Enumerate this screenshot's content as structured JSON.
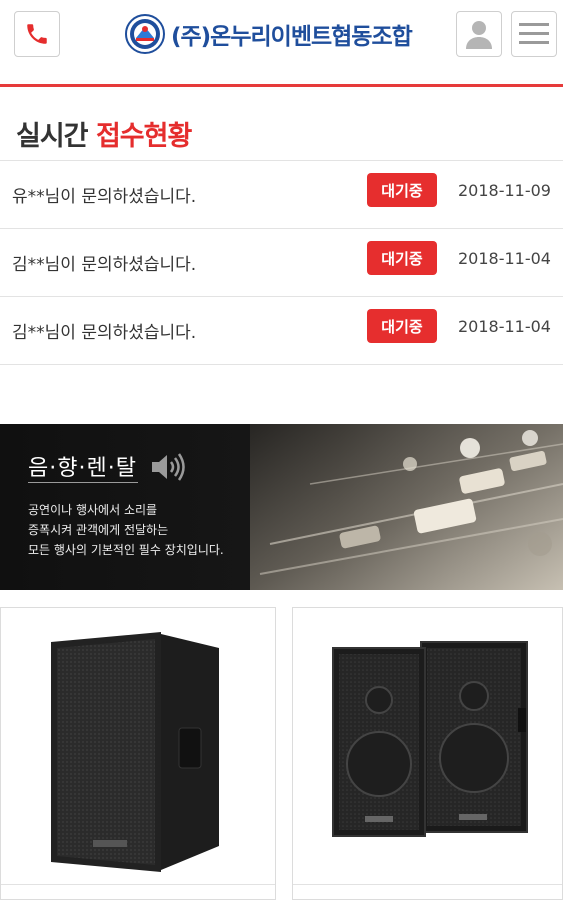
{
  "header": {
    "logo_text": "(주)온누리이벤트협동조합",
    "icons": {
      "phone": "phone-icon",
      "user": "user-icon",
      "menu": "hamburger-menu-icon"
    }
  },
  "colors": {
    "accent": "#e52d2d",
    "brand": "#1f4e9c",
    "badge": "#e62e2e"
  },
  "realtime": {
    "title_prefix": "실시간",
    "title_highlight": "접수현황",
    "items": [
      {
        "text": "유**님이 문의하셨습니다.",
        "status": "대기중",
        "date": "2018-11-09"
      },
      {
        "text": "김**님이 문의하셨습니다.",
        "status": "대기중",
        "date": "2018-11-04"
      },
      {
        "text": "김**님이 문의하셨습니다.",
        "status": "대기중",
        "date": "2018-11-04"
      }
    ]
  },
  "banner": {
    "title": "음·향·렌·탈",
    "desc_lines": [
      "공연이나 행사에서 소리를",
      "증폭시켜 관객에게 전달하는",
      "모든 행사의 기본적인 필수 장치입니다."
    ]
  },
  "products": [
    {
      "image": "single-pa-speaker-image"
    },
    {
      "image": "speaker-pair-image"
    }
  ]
}
